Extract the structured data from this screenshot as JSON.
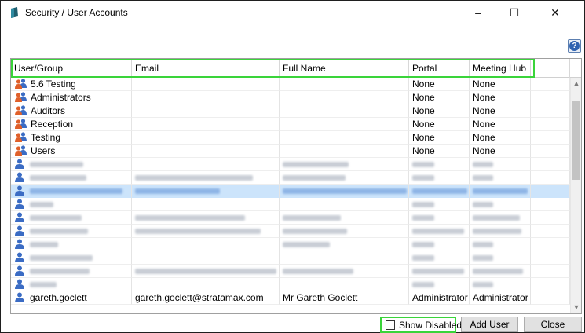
{
  "window": {
    "title": "Security / User Accounts",
    "controls": {
      "minimize": "–",
      "maximize": "☐",
      "close": "✕"
    }
  },
  "help": {
    "label": "?"
  },
  "grid": {
    "columns": [
      "User/Group",
      "Email",
      "Full Name",
      "Portal",
      "Meeting Hub",
      ""
    ],
    "group_rows": [
      {
        "name": "5.6 Testing",
        "email": "",
        "full_name": "",
        "portal": "None",
        "meeting_hub": "None"
      },
      {
        "name": "Administrators",
        "email": "",
        "full_name": "",
        "portal": "None",
        "meeting_hub": "None"
      },
      {
        "name": "Auditors",
        "email": "",
        "full_name": "",
        "portal": "None",
        "meeting_hub": "None"
      },
      {
        "name": "Reception",
        "email": "",
        "full_name": "",
        "portal": "None",
        "meeting_hub": "None"
      },
      {
        "name": "Testing",
        "email": "",
        "full_name": "",
        "portal": "None",
        "meeting_hub": "None"
      },
      {
        "name": "Users",
        "email": "",
        "full_name": "",
        "portal": "None",
        "meeting_hub": "None"
      }
    ],
    "partial_row": {
      "name": "gareth.goclett",
      "email": "gareth.goclett@stratamax.com",
      "full_name": "Mr Gareth Goclett",
      "portal": "Administrator",
      "meeting_hub": "Administrator"
    },
    "scroll": {
      "up": "▲",
      "down": "▼"
    }
  },
  "footer": {
    "show_disabled_label": "Show Disabled",
    "add_user_label": "Add User",
    "close_label": "Close"
  },
  "colors": {
    "highlight": "#3ad43a",
    "selected_row": "#cce4fb",
    "group_icon_front": "#e0602a",
    "group_icon_back": "#3b6cc4",
    "user_icon": "#3b6cc4"
  }
}
